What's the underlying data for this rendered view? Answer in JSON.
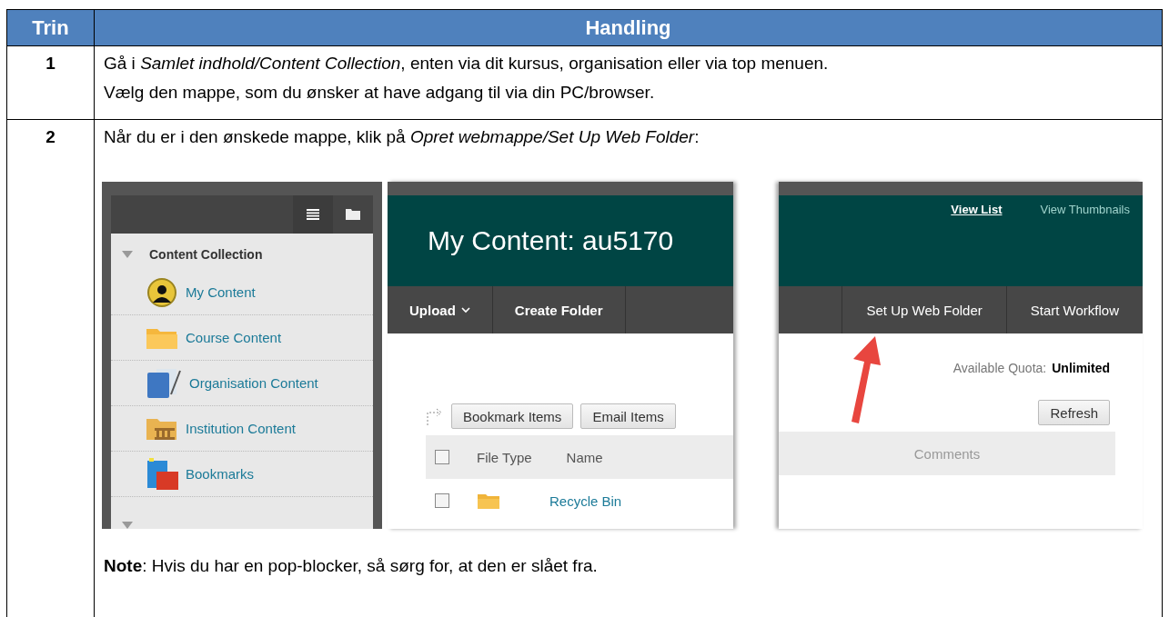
{
  "table": {
    "columns": [
      "Trin",
      "Handling"
    ],
    "rows": [
      {
        "step": "1",
        "paragraphs": [
          "Gå i *Samlet indhold/Content Collection*, enten via dit kursus, organisation eller via top menuen.",
          "Vælg den mappe, som du ønsker at have adgang til via din PC/browser."
        ]
      },
      {
        "step": "2",
        "intro": "Når du er i den ønskede mappe, klik på *Opret webmappe/Set Up Web Folder*:",
        "note": "**Note**: Hvis du har en pop-blocker, så sørg for, at den er slået fra."
      }
    ]
  },
  "screenshot": {
    "sidebar": {
      "title": "Content Collection",
      "items": [
        {
          "label": "My Content",
          "kind": "user"
        },
        {
          "label": "Course Content",
          "kind": "folder"
        },
        {
          "label": "Organisation Content",
          "kind": "book"
        },
        {
          "label": "Institution Content",
          "kind": "institution"
        },
        {
          "label": "Bookmarks",
          "kind": "bookmarks"
        }
      ]
    },
    "heading": "My Content: au5170",
    "view_links": [
      {
        "label": "View List",
        "selected": true
      },
      {
        "label": "View Thumbnails",
        "selected": false
      }
    ],
    "toolbar_left": [
      {
        "label": "Upload",
        "dropdown": true
      },
      {
        "label": "Create Folder",
        "dropdown": false
      }
    ],
    "toolbar_right": [
      "Set Up Web Folder",
      "Start Workflow"
    ],
    "quota_label": "Available Quota:",
    "quota_value": "Unlimited",
    "action_buttons": [
      "Bookmark Items",
      "Email Items"
    ],
    "refresh": "Refresh",
    "columns": [
      "File Type",
      "Name"
    ],
    "comments_column": "Comments",
    "select_all_checked": false,
    "rows": [
      {
        "name": "Recycle Bin",
        "checked": false
      }
    ]
  }
}
